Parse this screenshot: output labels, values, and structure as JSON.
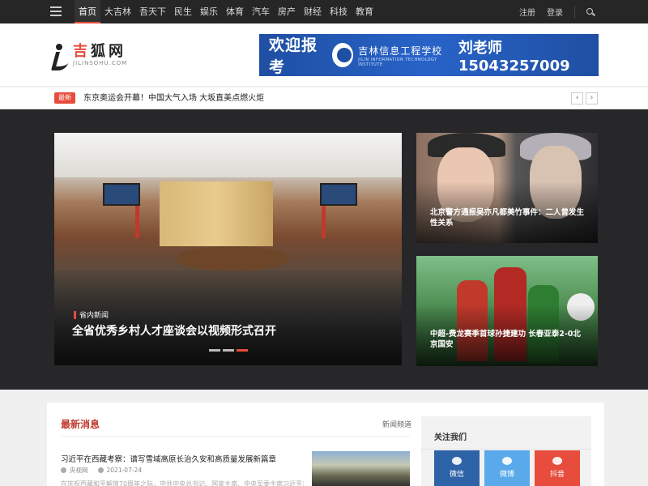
{
  "nav": {
    "items": [
      "首页",
      "大吉林",
      "吾天下",
      "民生",
      "娱乐",
      "体育",
      "汽车",
      "房产",
      "财经",
      "科技",
      "教育"
    ],
    "register": "注册",
    "login": "登录"
  },
  "logo": {
    "cn_prefix": "吉",
    "cn_rest": "狐网",
    "en": "JILINSOHU.COM"
  },
  "banner": {
    "text1": "欢迎报考",
    "school_cn": "吉林信息工程学校",
    "school_en": "JILIN INFORMATION TECHNOLOGY INSTITUTE",
    "text2": "刘老师 15043257009"
  },
  "ticker": {
    "badge": "最新",
    "headline": "东京奥运会开幕！中国大气入场 大坂直美点燃火炬",
    "prev": "‹",
    "next": "›"
  },
  "slider": {
    "tag": "省内新闻",
    "title": "全省优秀乡村人才座谈会以视频形式召开",
    "active_index": 2
  },
  "side_cards": [
    {
      "caption": "北京警方通报吴亦凡都美竹事件：二人曾发生性关系"
    },
    {
      "caption": "中超-费龙赛季首球孙捷建功 长春亚泰2-0北京国安"
    }
  ],
  "latest": {
    "title": "最新消息",
    "more": "新闻频道",
    "article": {
      "title": "习近平在西藏考察：谱写雪域高原长治久安和高质量发展新篇章",
      "source": "央视网",
      "date": "2021-07-24",
      "excerpt": "在庆祝西藏和平解放70周年之际，中共中央总书记、国家主席、中央军委主席习近平来到西"
    }
  },
  "follow": {
    "title": "关注我们",
    "wechat": "微信",
    "weibo": "微博",
    "douyin": "抖音"
  },
  "colors": {
    "accent": "#e74c3c",
    "nav_bg": "#262626",
    "feature_bg": "#27272a",
    "banner_bg": "#2863c8"
  }
}
